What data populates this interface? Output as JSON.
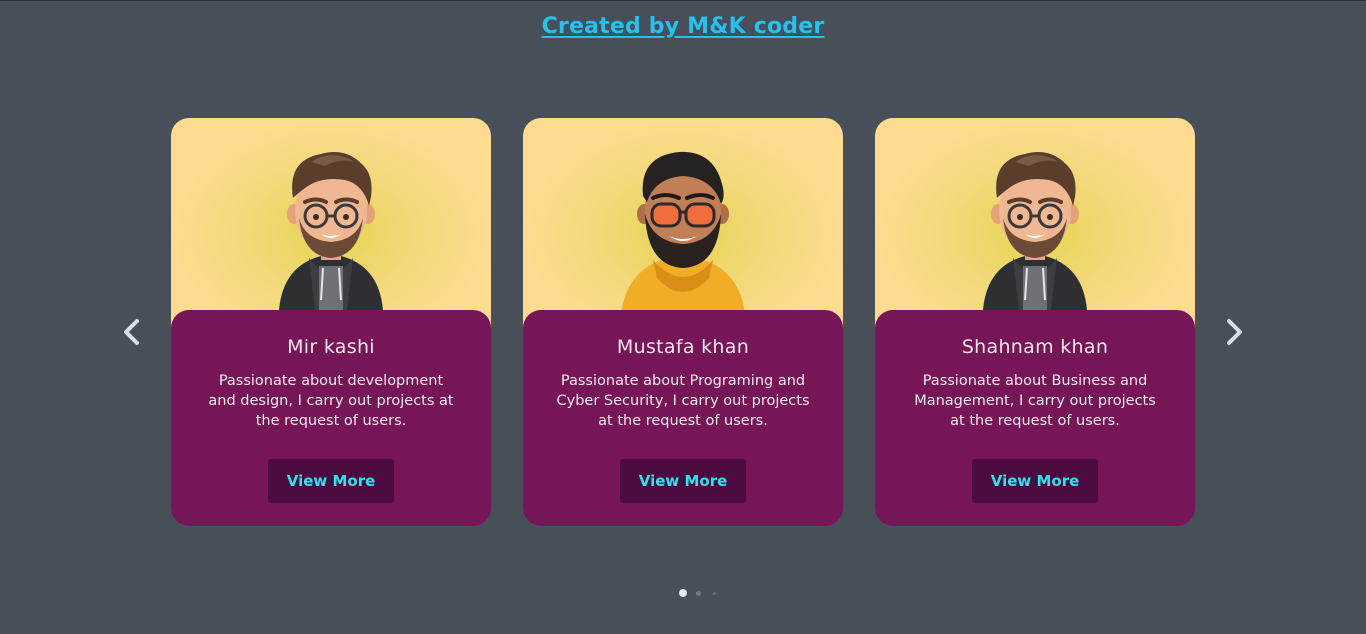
{
  "header": {
    "link_text": "Created by M&K coder"
  },
  "carousel": {
    "prev_icon": "chevron-left-icon",
    "next_icon": "chevron-right-icon",
    "cards": [
      {
        "name": "Mir kashi",
        "description": "Passionate about development and design, I carry out projects at the request of users.",
        "button_label": "View More",
        "avatar": "avatar-glasses-hoodie"
      },
      {
        "name": "Mustafa khan",
        "description": "Passionate about Programing and Cyber Security, I carry out projects at the request of users.",
        "button_label": "View More",
        "avatar": "avatar-orange-glasses-yellow-hoodie"
      },
      {
        "name": "Shahnam khan",
        "description": "Passionate about Business and Management, I carry out projects at the request of users.",
        "button_label": "View More",
        "avatar": "avatar-glasses-hoodie"
      }
    ],
    "pagination": {
      "pages": 3,
      "active": 1
    }
  },
  "colors": {
    "background": "#474f59",
    "link": "#22c3f1",
    "card_panel": "#761656",
    "button_bg": "#4b0b3e",
    "button_text": "#2ee3ef",
    "photo_bg": "#fedb90"
  }
}
